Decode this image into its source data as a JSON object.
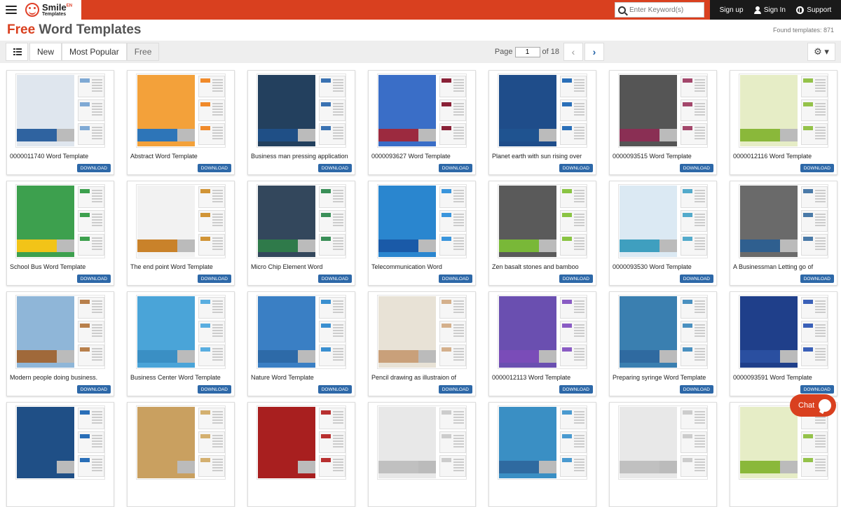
{
  "header": {
    "logo_name": "Smile",
    "logo_sup": "EN",
    "logo_sub": "Templates",
    "search_placeholder": "Enter Keyword(s)",
    "signup": "Sign up",
    "signin": "Sign In",
    "support": "Support"
  },
  "title": {
    "free": "Free",
    "rest": " Word Templates",
    "found": "Found templates: 871"
  },
  "toolbar": {
    "tabs": [
      "New",
      "Most Popular",
      "Free"
    ],
    "page_label": "Page",
    "page_value": "1",
    "page_of": "of 18",
    "prev": "‹",
    "next": "›",
    "gear": "⚙ ▾"
  },
  "download_label": "DOWNLOAD",
  "cards": [
    {
      "title": "0000011740 Word Template",
      "main": "#dfe6ee",
      "band": "#2f63a0",
      "accent": "#7fa9d4"
    },
    {
      "title": "Abstract Word Template",
      "main": "#f3a13a",
      "band": "#2d75b8",
      "accent": "#f08a2a"
    },
    {
      "title": "Business man pressing application",
      "main": "#23405e",
      "band": "#1f4f86",
      "accent": "#3a72b2"
    },
    {
      "title": "0000093627 Word Template",
      "main": "#3a6ec7",
      "band": "#9c2a3f",
      "accent": "#8a2137"
    },
    {
      "title": "Planet earth with sun rising over",
      "main": "#1f4d8a",
      "band": "#1f5390",
      "accent": "#2a6fb8"
    },
    {
      "title": "0000093515 Word Template",
      "main": "#555",
      "band": "#8a2f54",
      "accent": "#a3476b"
    },
    {
      "title": "0000012116 Word Template",
      "main": "#e6edc6",
      "band": "#8ab83a",
      "accent": "#94c24a"
    },
    {
      "title": "School Bus Word Template",
      "main": "#3da04e",
      "band": "#f2c418",
      "accent": "#3da04e"
    },
    {
      "title": "The end point Word Template",
      "main": "#f2f2f2",
      "band": "#c9822a",
      "accent": "#d19436"
    },
    {
      "title": "Micro Chip Element Word",
      "main": "#33475c",
      "band": "#2f7a4a",
      "accent": "#3a8f58"
    },
    {
      "title": "Telecommunication Word",
      "main": "#2a86cf",
      "band": "#1a5aa8",
      "accent": "#3a95dc"
    },
    {
      "title": "Zen basalt stones and bamboo",
      "main": "#5a5a5a",
      "band": "#79b838",
      "accent": "#8ac443"
    },
    {
      "title": "0000093530 Word Template",
      "main": "#dbe9f3",
      "band": "#3f9fbf",
      "accent": "#53aacb"
    },
    {
      "title": "A Businessman Letting go of",
      "main": "#6a6a6a",
      "band": "#2f5f8f",
      "accent": "#4a7aa8"
    },
    {
      "title": "Modern people doing business.",
      "main": "#8fb6d8",
      "band": "#a0693a",
      "accent": "#b8804c"
    },
    {
      "title": "Business Center Word Template",
      "main": "#4aa4d8",
      "band": "#3a8fc4",
      "accent": "#5aaee0"
    },
    {
      "title": "Nature Word Template",
      "main": "#3a7fc4",
      "band": "#2d6aa8",
      "accent": "#3a8fd0"
    },
    {
      "title": "Pencil drawing as illustraion of",
      "main": "#e8e2d6",
      "band": "#c9a07a",
      "accent": "#d4b08c"
    },
    {
      "title": "0000012113 Word Template",
      "main": "#6a4fb0",
      "band": "#7a4cb8",
      "accent": "#8a5cc4"
    },
    {
      "title": "Preparing syringe Word Template",
      "main": "#3a7fb0",
      "band": "#2f6aa0",
      "accent": "#4a90c0"
    },
    {
      "title": "0000093591 Word Template",
      "main": "#1f3f8a",
      "band": "#2a4fa0",
      "accent": "#3a60b8"
    },
    {
      "title": "",
      "main": "#1f4f86",
      "band": "#1f4f86",
      "accent": "#2a6fb8"
    },
    {
      "title": "",
      "main": "#c9a060",
      "band": "#c9a060",
      "accent": "#d4b070"
    },
    {
      "title": "",
      "main": "#a81f1f",
      "band": "#a81f1f",
      "accent": "#b83030"
    },
    {
      "title": "",
      "main": "#e8e8e8",
      "band": "#c0c0c0",
      "accent": "#ccc"
    },
    {
      "title": "",
      "main": "#3a8fc4",
      "band": "#2f6aa0",
      "accent": "#4a9ad0"
    },
    {
      "title": "",
      "main": "#e8e8e8",
      "band": "#c0c0c0",
      "accent": "#ccc"
    },
    {
      "title": "",
      "main": "#e6edc6",
      "band": "#8ab83a",
      "accent": "#94c24a"
    }
  ],
  "chat_label": "Chat"
}
